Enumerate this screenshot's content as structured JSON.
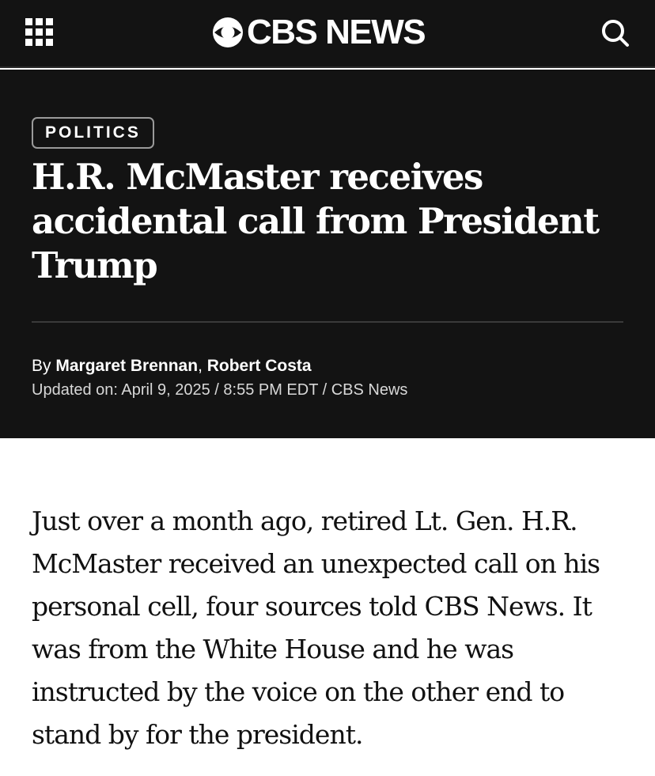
{
  "header": {
    "brand": "CBS NEWS",
    "menu_icon": "grid-menu-icon",
    "search_icon": "search-icon",
    "background": "#131313"
  },
  "article": {
    "category": "POLITICS",
    "headline": "H.R. McMaster receives accidental call from President Trump",
    "byline_prefix": "By ",
    "authors": [
      "Margaret Brennan",
      "Robert Costa"
    ],
    "author_separator": ", ",
    "updated": "Updated on: April 9, 2025 / 8:55 PM EDT / CBS News",
    "body": "Just over a month ago, retired Lt. Gen. H.R. McMaster received an unexpected call on his personal cell, four sources told CBS News. It was from the White House and he was instructed by the voice on the other end to stand by for the president."
  }
}
